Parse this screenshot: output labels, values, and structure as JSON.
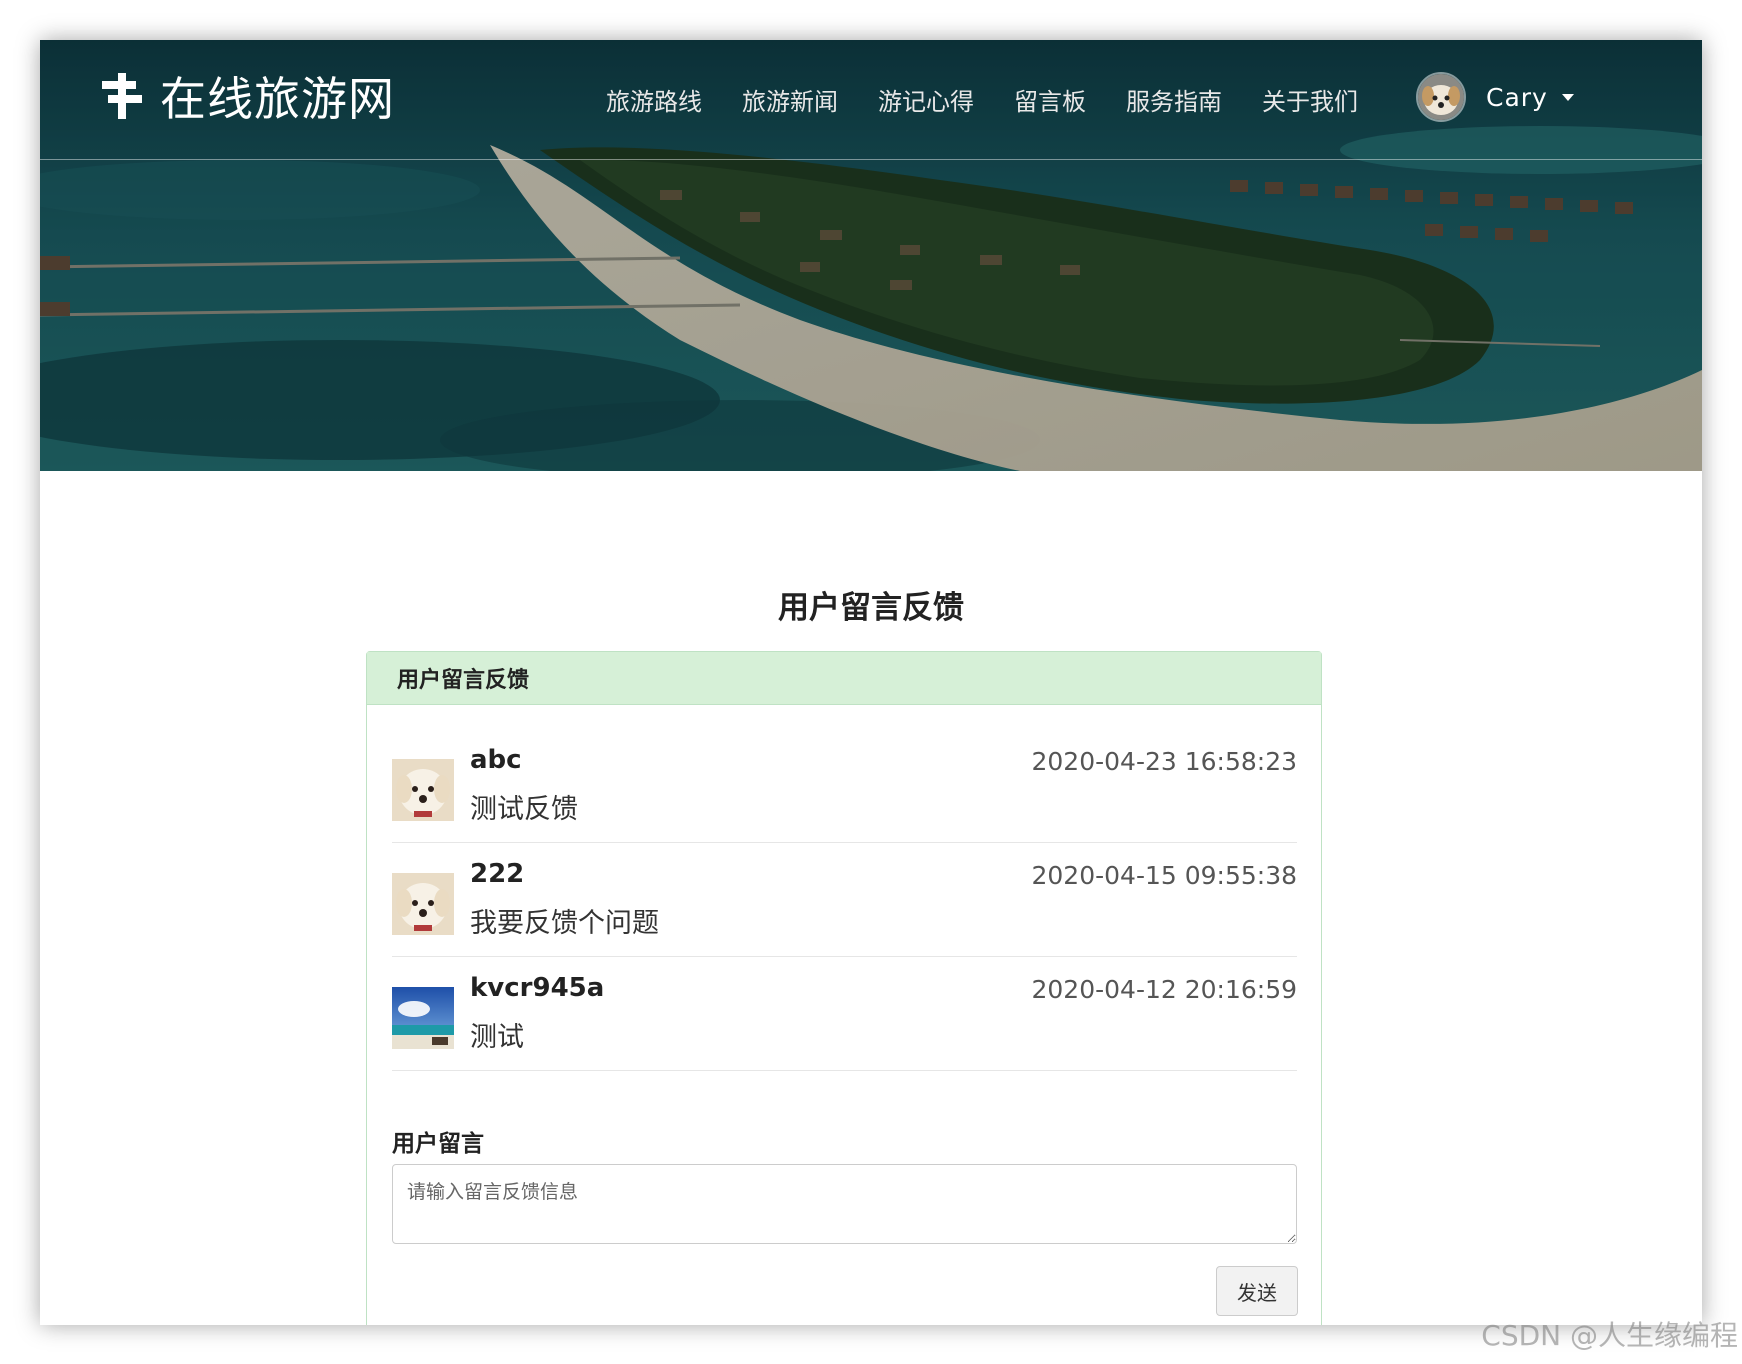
{
  "site": {
    "brand_icon": "signpost-icon",
    "title": "在线旅游网"
  },
  "nav": {
    "items": [
      {
        "label": "旅游路线"
      },
      {
        "label": "旅游新闻"
      },
      {
        "label": "游记心得"
      },
      {
        "label": "留言板"
      },
      {
        "label": "服务指南"
      },
      {
        "label": "关于我们"
      }
    ],
    "user": {
      "name": "Cary",
      "avatar": "dog-avatar",
      "menu_icon": "caret-down-icon"
    }
  },
  "page": {
    "title": "用户留言反馈"
  },
  "panel": {
    "heading": "用户留言反馈",
    "messages": [
      {
        "user": "abc",
        "text": "测试反馈",
        "time": "2020-04-23 16:58:23",
        "avatar": "dog-avatar"
      },
      {
        "user": "222",
        "text": "我要反馈个问题",
        "time": "2020-04-15 09:55:38",
        "avatar": "dog-avatar"
      },
      {
        "user": "kvcr945a",
        "text": "测试",
        "time": "2020-04-12 20:16:59",
        "avatar": "beach-avatar"
      }
    ]
  },
  "form": {
    "label": "用户留言",
    "placeholder": "请输入留言反馈信息",
    "value": "",
    "submit_label": "发送"
  },
  "watermark": "CSDN @人生缘编程",
  "colors": {
    "panel_heading_bg": "#d6f0d7",
    "panel_border": "#bfe2c4",
    "nav_text": "#ffffff"
  }
}
